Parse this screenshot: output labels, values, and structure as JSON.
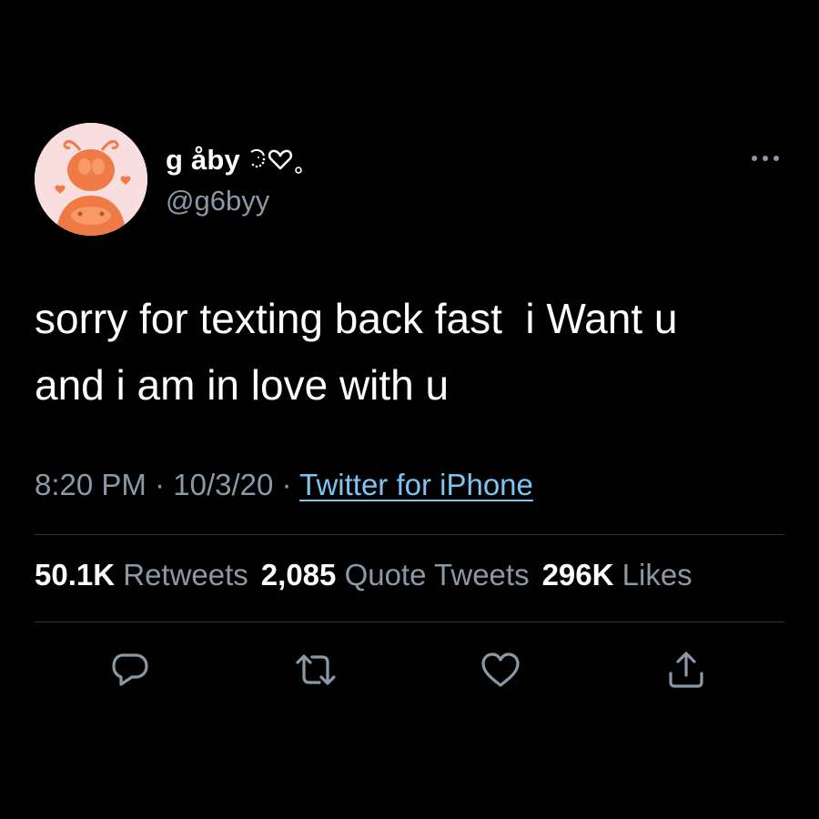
{
  "colors": {
    "background": "#000000",
    "text_primary": "#ffffff",
    "text_secondary": "#8b98a5",
    "link": "#7cc4f2",
    "divider": "#2f3336",
    "avatar_bg": "#f8dede",
    "avatar_accent": "#f07a45"
  },
  "author": {
    "display_name": "g åby",
    "handle": "@g6byy",
    "avatar_icon": "orange-creature-avatar",
    "name_decoration_icon": "sparkle-heart-icon"
  },
  "tweet": {
    "text": "sorry for texting back fast  i Want u\nand i am in love with u",
    "time": "8:20 PM",
    "separator": "·",
    "date": "10/3/20",
    "source": "Twitter for iPhone"
  },
  "stats": [
    {
      "count": "50.1K",
      "label": "Retweets"
    },
    {
      "count": "2,085",
      "label": "Quote Tweets"
    },
    {
      "count": "296K",
      "label": "Likes"
    }
  ],
  "actions": [
    {
      "icon": "reply-icon"
    },
    {
      "icon": "retweet-icon"
    },
    {
      "icon": "like-icon"
    },
    {
      "icon": "share-icon"
    }
  ],
  "more_icon": "more-options-icon"
}
